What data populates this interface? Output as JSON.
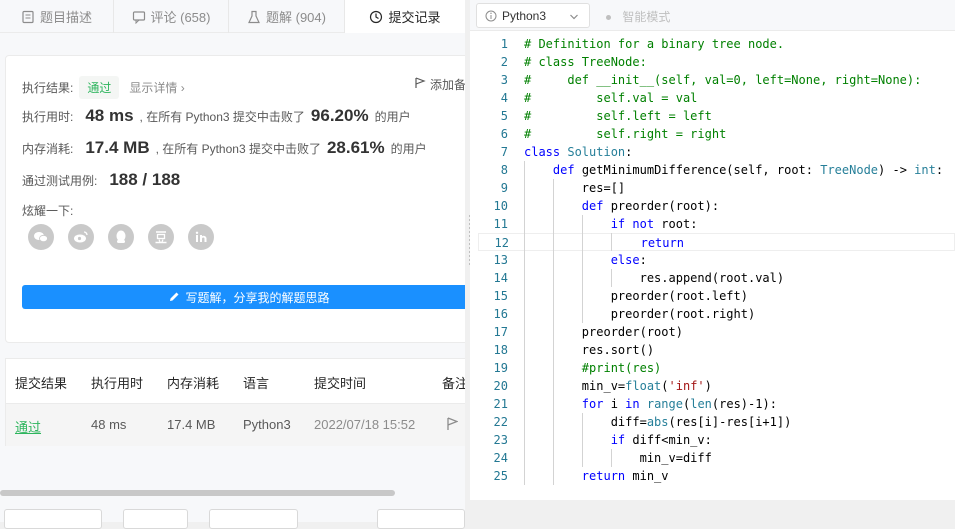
{
  "tabs": [
    {
      "label": "题目描述",
      "icon": "document-icon"
    },
    {
      "label": "评论 (658)",
      "icon": "comment-icon"
    },
    {
      "label": "题解 (904)",
      "icon": "flask-icon"
    },
    {
      "label": "提交记录",
      "icon": "clock-icon",
      "active": true
    }
  ],
  "result": {
    "label": "执行结果:",
    "status": "通过",
    "detail_link": "显示详情 ›",
    "add_note": "添加备",
    "time_label": "执行用时:",
    "time_value": "48 ms",
    "time_text": ", 在所有 Python3 提交中击败了",
    "time_pct": "96.20%",
    "time_suffix": "的用户",
    "mem_label": "内存消耗:",
    "mem_value": "17.4 MB",
    "mem_text": ", 在所有 Python3 提交中击败了",
    "mem_pct": "28.61%",
    "mem_suffix": "的用户",
    "cases_label": "通过测试用例:",
    "cases_value": "188 / 188",
    "share_label": "炫耀一下:",
    "share_icons": [
      "wechat-icon",
      "weibo-icon",
      "qq-icon",
      "douban-icon",
      "linkedin-icon"
    ],
    "write_button": "写题解，分享我的解题思路"
  },
  "table": {
    "headers": [
      "提交结果",
      "执行用时",
      "内存消耗",
      "语言",
      "提交时间",
      "备注"
    ],
    "rows": [
      {
        "status": "通过",
        "time": "48 ms",
        "memory": "17.4 MB",
        "lang": "Python3",
        "submitted": "2022/07/18 15:52"
      }
    ]
  },
  "editor": {
    "language": "Python3",
    "smart_mode": "智能模式",
    "current_line": 12,
    "lines": [
      "# Definition for a binary tree node.",
      "# class TreeNode:",
      "#     def __init__(self, val=0, left=None, right=None):",
      "#         self.val = val",
      "#         self.left = left",
      "#         self.right = right",
      "class Solution:",
      "    def getMinimumDifference(self, root: TreeNode) -> int:",
      "        res=[]",
      "        def preorder(root):",
      "            if not root:",
      "                return",
      "            else:",
      "                res.append(root.val)",
      "            preorder(root.left)",
      "            preorder(root.right)",
      "        preorder(root)",
      "        res.sort()",
      "        #print(res)",
      "        min_v=float('inf')",
      "        for i in range(len(res)-1):",
      "            diff=abs(res[i]-res[i+1])",
      "            if diff<min_v:",
      "                min_v=diff",
      "        return min_v"
    ]
  },
  "colors": {
    "accent": "#1a90ff",
    "pass": "#2db55d"
  }
}
